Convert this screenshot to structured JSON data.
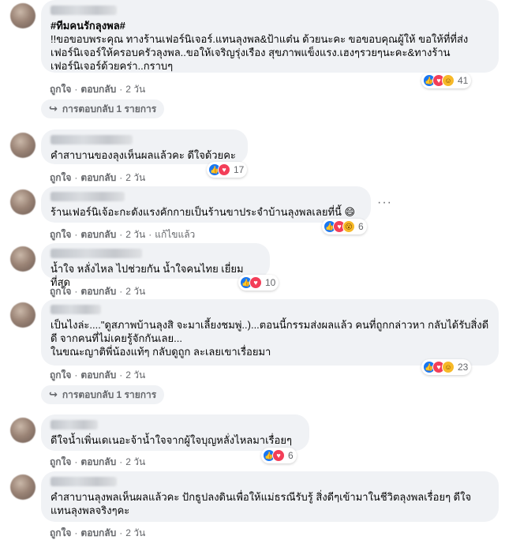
{
  "comments": [
    {
      "text_tag": "#ทีมคนรักลุงพล#",
      "text": "!!ขอขอบพระคุณ ทางร้านเฟอร์นิเจอร์.แทนลุงพล&ป้าแต๋น ด้วยนะคะ ขอขอบคุณผู้ให้ ขอให้ที่ที่ส่งเฟอร์นิเจอร์ให้ครอบครัวลุงพล..ขอให้เจริญรุ่งเรือง สุขภาพแข็งแรง.เฮงๆรวยๆนะคะ&ทางร้านเฟอร์นิเจอร์ด้วยคร่า..กราบๆ",
      "reactions": [
        "like-icon",
        "love-icon",
        "care-icon"
      ],
      "reaction_count": "41",
      "like": "ถูกใจ",
      "reply": "ตอบกลับ",
      "time": "2 วัน",
      "replies_link": "การตอบกลับ 1 รายการ"
    },
    {
      "text": "คำสาบานของลุงเห็นผลแล้วคะ ดีใจด้วยคะ",
      "reactions": [
        "like-icon",
        "love-icon"
      ],
      "reaction_count": "17",
      "like": "ถูกใจ",
      "reply": "ตอบกลับ",
      "time": "2 วัน"
    },
    {
      "text": "ร้านเฟอร์นิเจ้อะกะดังแรงคักกายเป็นร้านขาประจำบ้านลุงพลเลยที่นี้ 😄",
      "reactions": [
        "like-icon",
        "love-icon",
        "wow-icon"
      ],
      "reaction_count": "6",
      "like": "ถูกใจ",
      "reply": "ตอบกลับ",
      "time": "2 วัน",
      "edited": "แก้ไขแล้ว"
    },
    {
      "text": "น้ำใจ หลั่งไหล ไปช่วยกัน น้ำใจคนไทย เยี่ยมที่สุด",
      "reactions": [
        "like-icon",
        "love-icon"
      ],
      "reaction_count": "10",
      "like": "ถูกใจ",
      "reply": "ตอบกลับ",
      "time": "2 วัน"
    },
    {
      "text": "เป็นไงล่ะ....\"ดูสภาพบ้านลุงสิ จะมาเลี้ยงชมพู่..)...ตอนนี้กรรมส่งผลแล้ว คนที่ถูกกล่าวหา กลับได้รับสิ่งดีดี จากคนที่ไม่เคยรู้จักกันเลย...\nในขณะญาติพี่น้องแท้ๆ กลับดูถูก ละเลยเขาเรื่อยมา",
      "reactions": [
        "like-icon",
        "love-icon",
        "care-icon"
      ],
      "reaction_count": "23",
      "like": "ถูกใจ",
      "reply": "ตอบกลับ",
      "time": "2 วัน",
      "replies_link": "การตอบกลับ 1 รายการ"
    },
    {
      "text": "ดีใจน้ำเพิ่นเดเนอะจ้าน้ำใจจากผู้ใจบุญหลั่งไหลมาเรื่อยๆ",
      "reactions": [
        "like-icon",
        "love-icon"
      ],
      "reaction_count": "6",
      "like": "ถูกใจ",
      "reply": "ตอบกลับ",
      "time": "2 วัน"
    },
    {
      "text": "คำสาบานลุงพลเห็นผลแล้วคะ ปักธูปลงดินเพื่อให้แม่ธรณีรับรู้ สิ่งดีๆเข้ามาในชีวิตลุงพลเรื่อยๆ ดีใจแทนลุงพลจริงๆคะ",
      "like": "ถูกใจ",
      "reply": "ตอบกลับ",
      "time": "2 วัน"
    }
  ],
  "more_icon": "more-options-icon",
  "colors": {
    "bubble": "#f0f2f5",
    "like": "#1877f2",
    "love": "#f33e58",
    "secondary_text": "#65676b"
  }
}
